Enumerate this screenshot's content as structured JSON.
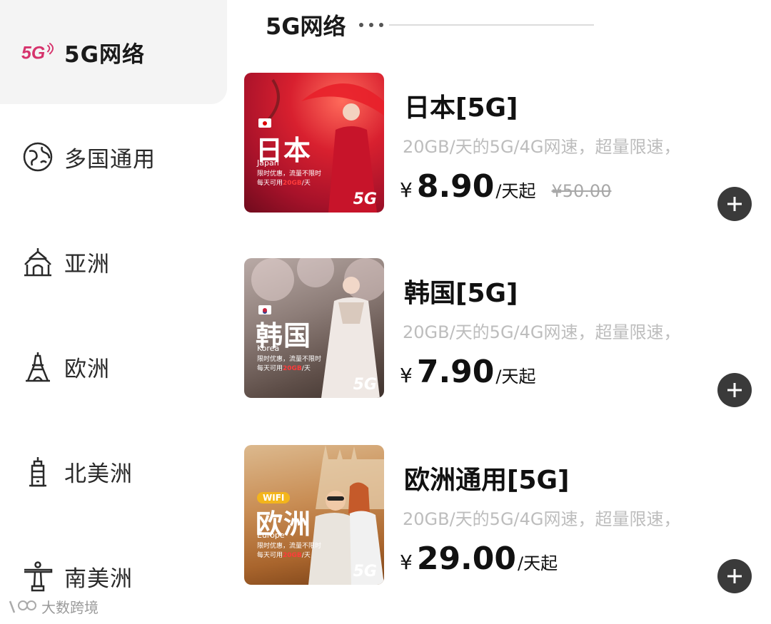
{
  "sidebar": {
    "items": [
      {
        "label": "5G网络",
        "icon": "5g-icon",
        "active": true
      },
      {
        "label": "多国通用",
        "icon": "globe-icon"
      },
      {
        "label": "亚洲",
        "icon": "temple-icon"
      },
      {
        "label": "欧洲",
        "icon": "eiffel-tower-icon"
      },
      {
        "label": "北美洲",
        "icon": "tower-icon"
      },
      {
        "label": "南美洲",
        "icon": "christ-statue-icon"
      }
    ],
    "icon_text_5g": "5G"
  },
  "section": {
    "title": "5G网络"
  },
  "products": [
    {
      "name": "日本[5G]",
      "desc": "20GB/天的5G/4G网速，超量限速，",
      "yen": "¥",
      "price": "8.90",
      "unit": "/天起",
      "orig_price": "¥50.00",
      "thumb_title": "日本",
      "thumb_sub": "Japan",
      "thumb_promo_1": "限时优惠，流量不限时",
      "thumb_promo_2a": "每天可用",
      "thumb_promo_2b": "20GB",
      "thumb_promo_2c": "/天",
      "thumb_5g": "5G"
    },
    {
      "name": "韩国[5G]",
      "desc": "20GB/天的5G/4G网速，超量限速，",
      "yen": "¥",
      "price": "7.90",
      "unit": "/天起",
      "thumb_title": "韩国",
      "thumb_sub": "Korea",
      "thumb_promo_1": "限时优惠，流量不限时",
      "thumb_promo_2a": "每天可用",
      "thumb_promo_2b": "20GB",
      "thumb_promo_2c": "/天",
      "thumb_5g": "5G"
    },
    {
      "name": "欧洲通用[5G]",
      "desc": "20GB/天的5G/4G网速，超量限速，",
      "yen": "¥",
      "price": "29.00",
      "unit": "/天起",
      "thumb_title": "欧洲",
      "thumb_sub": "Europe",
      "thumb_tag": "WIFI",
      "thumb_promo_1": "限时优惠，流量不限时",
      "thumb_promo_2a": "每天可用",
      "thumb_promo_2b": "20GB",
      "thumb_promo_2c": "/天",
      "thumb_5g": "5G"
    }
  ],
  "watermark": "大数跨境",
  "colors": {
    "accent_5g": "#d6336c",
    "button": "#3a3a3a",
    "muted": "#bdbdbd",
    "active_bg": "#f4f4f4"
  }
}
